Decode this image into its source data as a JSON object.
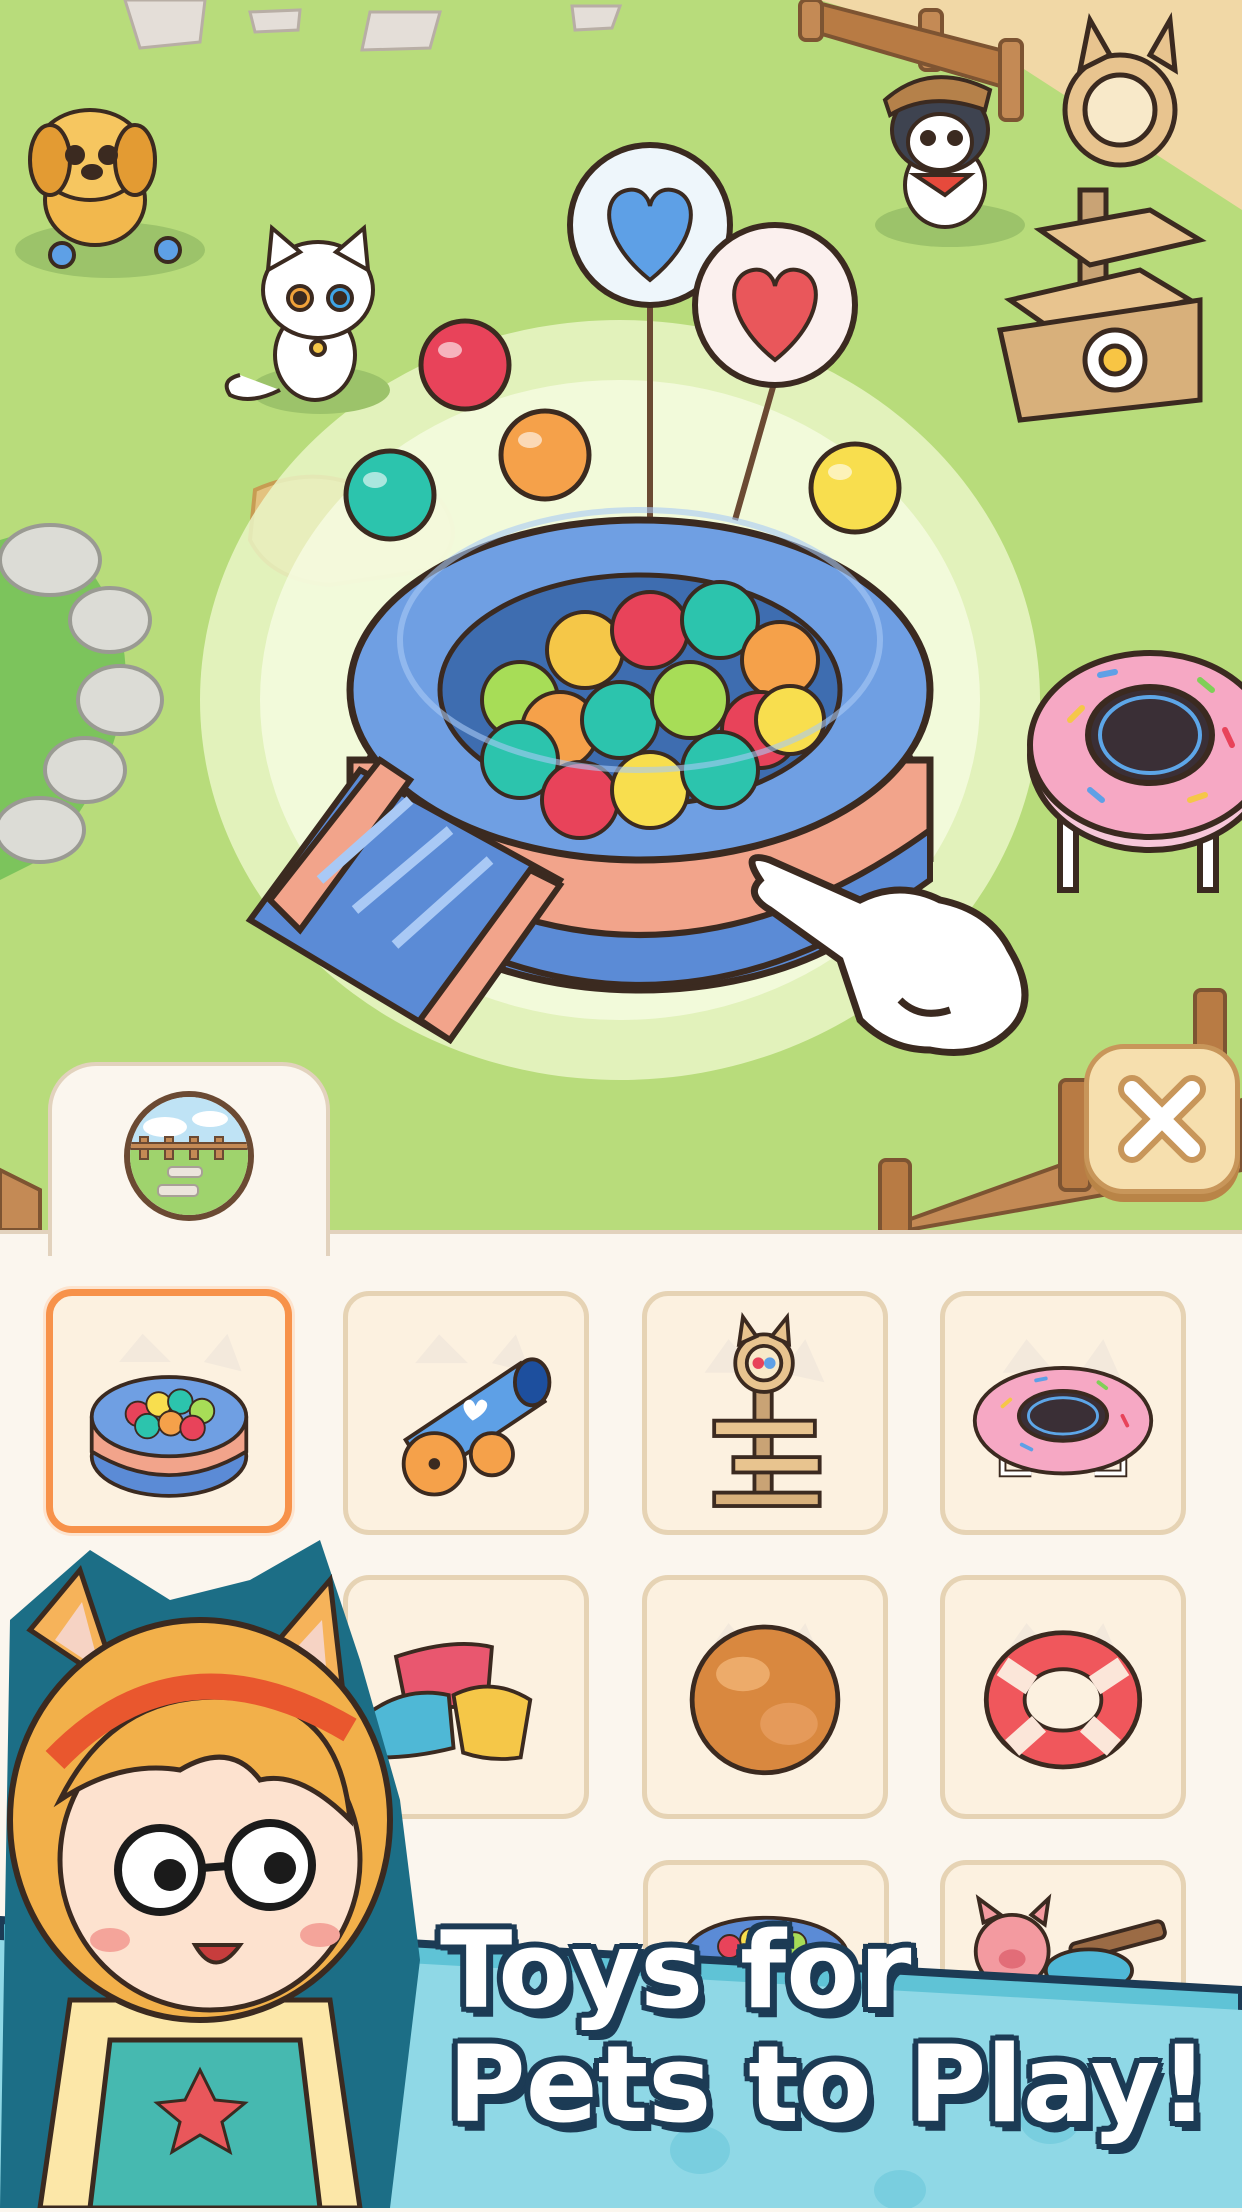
{
  "promo": {
    "headline_line1": "Toys for",
    "headline_line2": "Pets to Play!"
  },
  "scene": {
    "highlighted_item": "ball pit",
    "pets": [
      "golden dog",
      "white cat",
      "husky"
    ]
  },
  "inventory": {
    "tab_icon": "park-scene-icon",
    "items": [
      {
        "name": "ball-pit",
        "selected": true
      },
      {
        "name": "ball-cannon",
        "selected": false
      },
      {
        "name": "cat-tree",
        "selected": false
      },
      {
        "name": "donut-trampoline",
        "selected": false
      },
      {
        "name": "pillows",
        "selected": false
      },
      {
        "name": "leather-ball",
        "selected": false
      },
      {
        "name": "swim-ring",
        "selected": false
      },
      {
        "name": "ball-pit-small",
        "selected": false
      },
      {
        "name": "pig-toy",
        "selected": false
      }
    ]
  },
  "colors": {
    "grass": "#b9dd7c",
    "panel": "#fbf6ee",
    "selected_border": "#f7924a",
    "outline": "#1c3b55"
  }
}
